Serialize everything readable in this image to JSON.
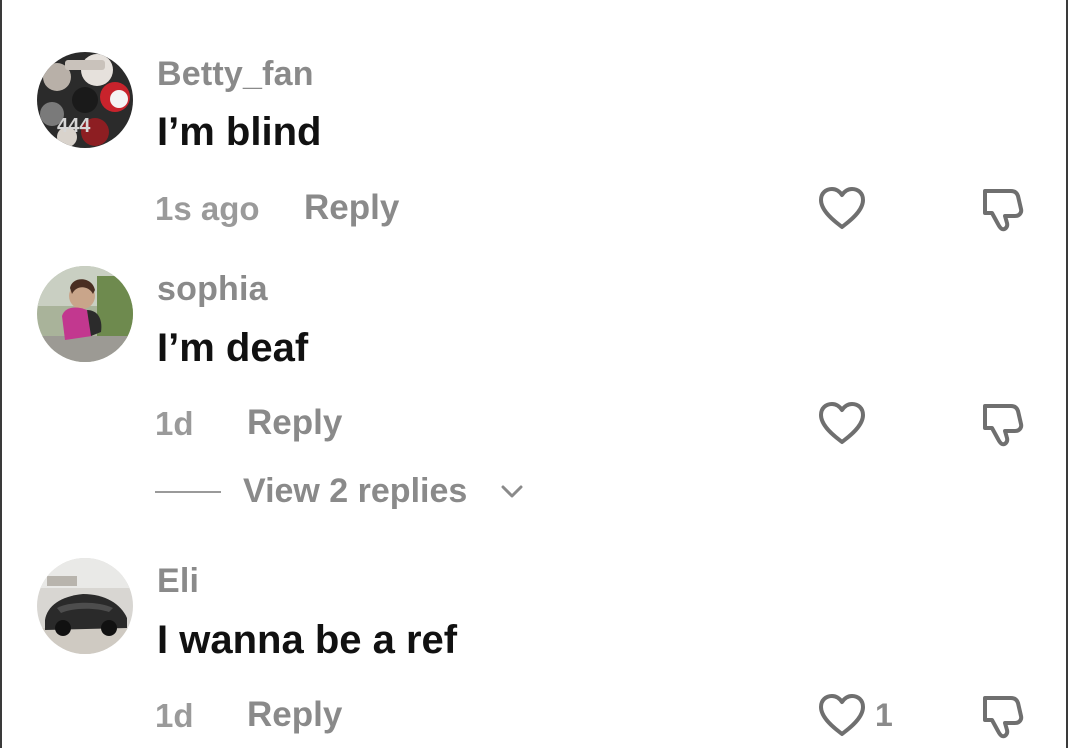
{
  "comments": [
    {
      "username": "Betty_fan",
      "text": "I’m blind",
      "time": "1s ago",
      "reply_label": "Reply",
      "avatar": "collage-avatar",
      "avatar_text": "444"
    },
    {
      "username": "sophia",
      "text": "I’m deaf",
      "time": "1d",
      "reply_label": "Reply",
      "avatar": "child-photo-avatar"
    },
    {
      "username": "Eli",
      "text": "I wanna be a ref",
      "time": "1d",
      "reply_label": "Reply",
      "avatar": "car-photo-avatar",
      "like_count": "1"
    }
  ],
  "view_replies": {
    "label": "View 2 replies",
    "icon": "chevron-down-icon"
  },
  "icons": {
    "like": "heart-outline-icon",
    "dislike": "thumbs-down-outline-icon"
  },
  "colors": {
    "username": "#8a8a8a",
    "text": "#111111",
    "meta": "#9a9a9a",
    "icon": "#6f6f6f"
  }
}
